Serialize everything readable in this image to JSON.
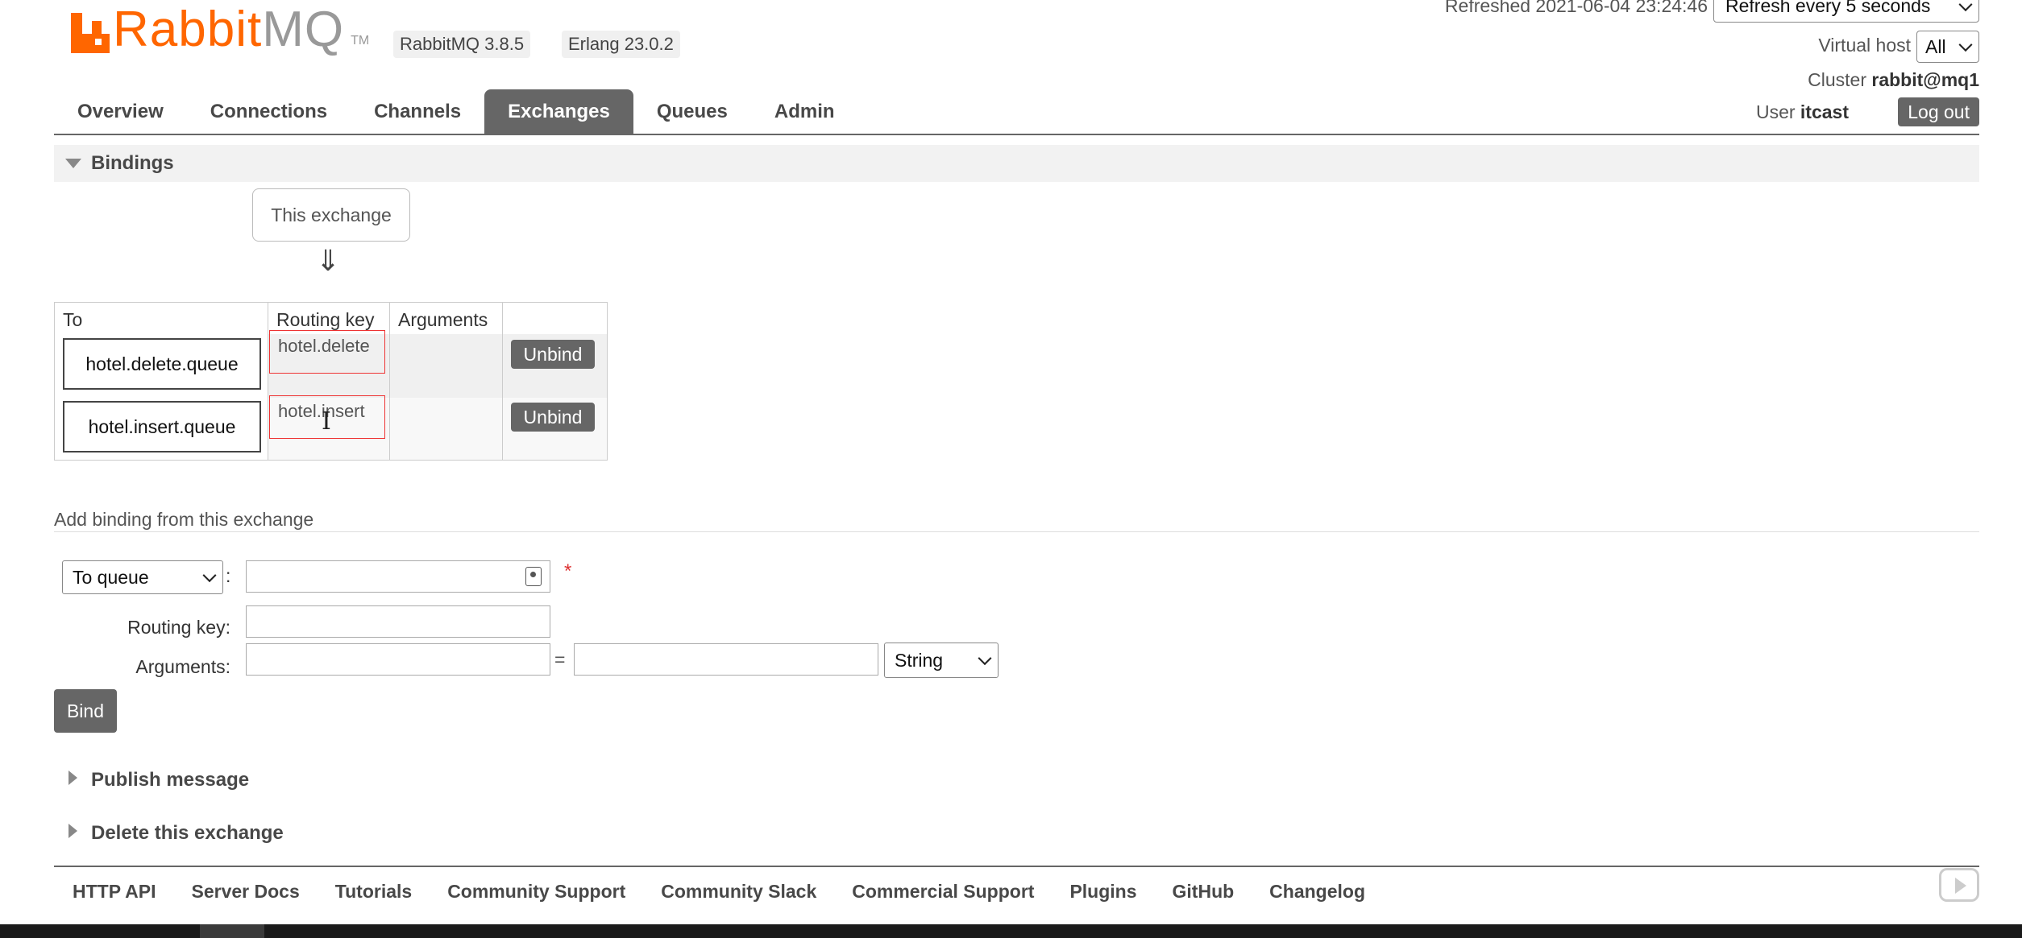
{
  "header": {
    "logo_text_main": "Rabbit",
    "logo_text_mq": "MQ",
    "logo_tm": "TM",
    "rabbitmq_version": "RabbitMQ 3.8.5",
    "erlang_version": "Erlang 23.0.2",
    "refreshed": "Refreshed 2021-06-04 23:24:46",
    "refresh_option": "Refresh every 5 seconds",
    "vhost_label": "Virtual host",
    "vhost_value": "All",
    "cluster_label": "Cluster",
    "cluster_value": "rabbit@mq1",
    "user_label": "User",
    "user_value": "itcast",
    "logout_label": "Log out"
  },
  "nav": {
    "items": [
      {
        "label": "Overview"
      },
      {
        "label": "Connections"
      },
      {
        "label": "Channels"
      },
      {
        "label": "Exchanges",
        "active": true
      },
      {
        "label": "Queues"
      },
      {
        "label": "Admin"
      }
    ]
  },
  "bindings": {
    "title": "Bindings",
    "this_exchange": "This exchange",
    "arrow": "⇓",
    "columns": [
      "To",
      "Routing key",
      "Arguments",
      ""
    ],
    "rows": [
      {
        "to": "hotel.delete.queue",
        "routing_key": "hotel.delete",
        "arguments": "",
        "action": "Unbind"
      },
      {
        "to": "hotel.insert.queue",
        "routing_key": "hotel.insert",
        "arguments": "",
        "action": "Unbind"
      }
    ]
  },
  "add_binding": {
    "title": "Add binding from this exchange",
    "destination_type": "To queue",
    "destination_value": "",
    "required_mark": "*",
    "routing_key_label": "Routing key:",
    "routing_key_value": "",
    "arguments_label": "Arguments:",
    "argument_key": "",
    "equals": "=",
    "argument_value": "",
    "argument_type": "String",
    "bind_label": "Bind"
  },
  "sections": {
    "publish_message": "Publish message",
    "delete_exchange": "Delete this exchange"
  },
  "footer": {
    "links": [
      "HTTP API",
      "Server Docs",
      "Tutorials",
      "Community Support",
      "Community Slack",
      "Commercial Support",
      "Plugins",
      "GitHub",
      "Changelog"
    ]
  },
  "colors": {
    "brand_orange": "#ff6600",
    "nav_active_bg": "#666666",
    "highlight_red": "#ee3333"
  }
}
